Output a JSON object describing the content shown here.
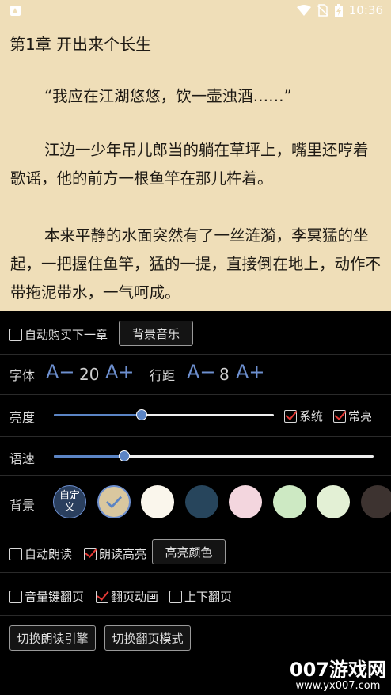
{
  "status_bar": {
    "time": "10:36"
  },
  "reader": {
    "chapter_title": "第1章 开出来个长生",
    "paragraphs": [
      "“我应在江湖悠悠，饮一壶浊酒……”",
      "江边一少年吊儿郎当的躺在草坪上，嘴里还哼着歌谣，他的前方一根鱼竿在那儿杵着。",
      "本来平静的水面突然有了一丝涟漪，李冥猛的坐起，一把握住鱼竿，猛的一提，直接倒在地上，动作不带拖泥带水，一气呵成。"
    ],
    "background_color": "#efdeb8"
  },
  "settings": {
    "auto_buy": {
      "label": "自动购买下一章",
      "checked": false
    },
    "bg_music_button": "背景音乐",
    "font": {
      "label": "字体",
      "decrease": "A−",
      "increase": "A+",
      "size": "20"
    },
    "line_spacing": {
      "label": "行距",
      "decrease": "A−",
      "increase": "A+",
      "value": "8"
    },
    "brightness": {
      "label": "亮度",
      "level": 0.4,
      "system_label": "系统",
      "system_checked": true,
      "always_on_label": "常亮",
      "always_on_checked": true
    },
    "speech_rate": {
      "label": "语速",
      "level": 0.22
    },
    "background": {
      "label": "背景",
      "custom_label": "自定义",
      "selected_index": 1,
      "swatches": [
        "#2a3f5e",
        "#d9c79f",
        "#faf6ec",
        "#27455c",
        "#f3d6de",
        "#cde9c3",
        "#e3f0d5",
        "#3d3330"
      ]
    },
    "auto_read": {
      "label": "自动朗读",
      "checked": false
    },
    "read_highlight": {
      "label": "朗读高亮",
      "checked": true
    },
    "highlight_color_button": "高亮颜色",
    "volume_key_page": {
      "label": "音量键翻页",
      "checked": false
    },
    "page_animation": {
      "label": "翻页动画",
      "checked": true
    },
    "vertical_page": {
      "label": "上下翻页",
      "checked": false
    },
    "switch_engine_button": "切换朗读引擎",
    "switch_mode_button": "切换翻页模式"
  },
  "watermark": {
    "text": "007游戏网",
    "url": "www.yx007.com"
  }
}
